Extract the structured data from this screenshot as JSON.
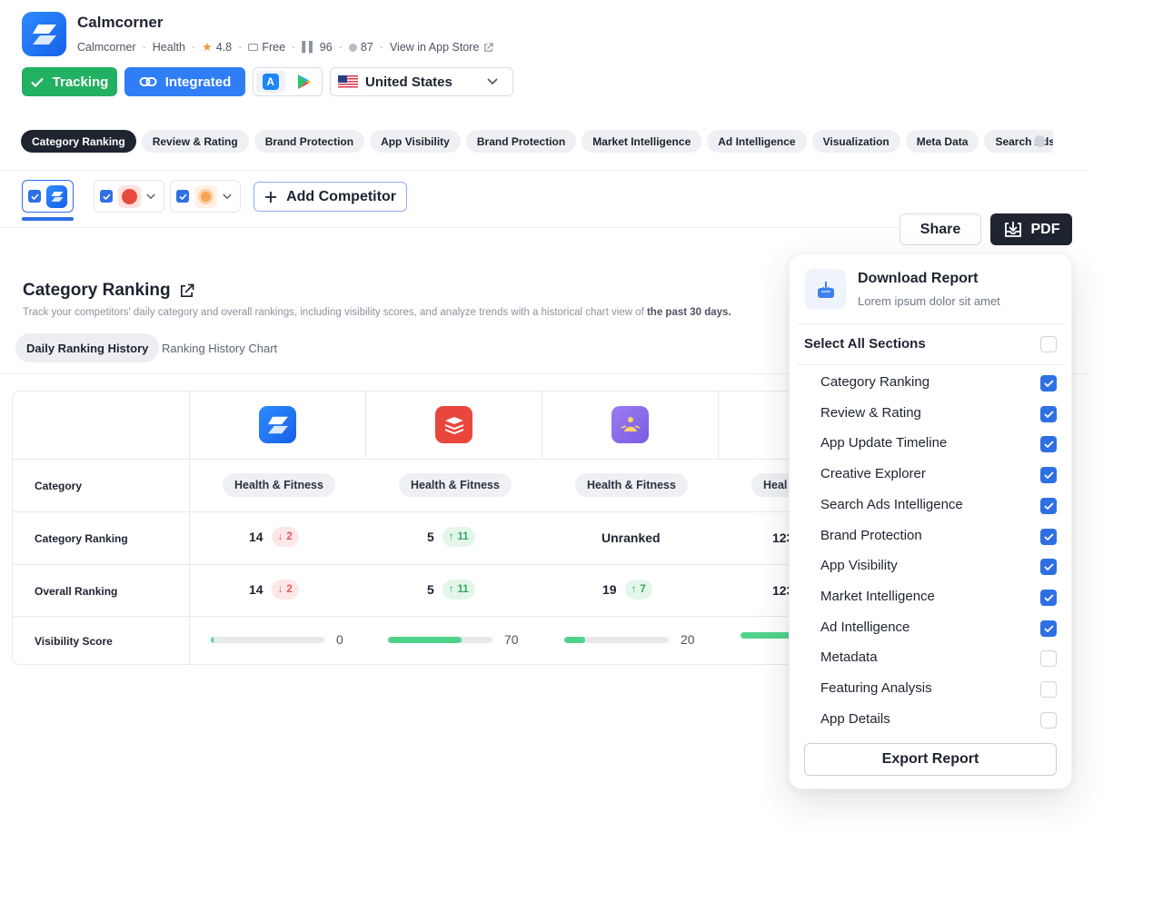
{
  "app": {
    "name": "Calmcorner",
    "developer": "Calmcorner",
    "category": "Health",
    "rating": "4.8",
    "price": "Free",
    "rank_value": "96",
    "score_value": "87",
    "store_link": "View in App Store"
  },
  "actions": {
    "tracking": "Tracking",
    "integrated": "Integrated",
    "country": "United States",
    "share": "Share",
    "pdf": "PDF",
    "add_competitor": "Add Competitor"
  },
  "tabs": [
    "Category Ranking",
    "Review & Rating",
    "Brand Protection",
    "App Visibility",
    "Brand Protection",
    "Market Intelligence",
    "Ad Intelligence",
    "Visualization",
    "Meta Data",
    "Search Ads"
  ],
  "section": {
    "title": "Category Ranking",
    "desc_prefix": "Track your competitors' daily category and overall rankings, including visibility scores, and analyze trends with a historical chart view of ",
    "desc_bold": "the past 30 days.",
    "subtab_active": "Daily Ranking History",
    "subtab_inactive": "Ranking History Chart"
  },
  "table": {
    "row_labels": [
      "Category",
      "Category Ranking",
      "Overall  Ranking",
      "Visibility Score"
    ],
    "columns": [
      {
        "category": "Health & Fitness",
        "cat_rank": "14",
        "cat_change": "2",
        "cat_dir": "down",
        "overall": "14",
        "overall_change": "2",
        "overall_dir": "down",
        "visibility": 0
      },
      {
        "category": "Health & Fitness",
        "cat_rank": "5",
        "cat_change": "11",
        "cat_dir": "up",
        "overall": "5",
        "overall_change": "11",
        "overall_dir": "up",
        "visibility": 70
      },
      {
        "category": "Health & Fitness",
        "cat_rank": "Unranked",
        "overall": "19",
        "overall_change": "7",
        "overall_dir": "up",
        "visibility": 20
      },
      {
        "category": "Heal",
        "cat_rank": "123",
        "overall": "123"
      }
    ]
  },
  "panel": {
    "title": "Download Report",
    "subtitle": "Lorem ipsum dolor sit amet",
    "select_all": "Select All Sections",
    "items": [
      {
        "label": "Category Ranking",
        "checked": true
      },
      {
        "label": "Review & Rating",
        "checked": true
      },
      {
        "label": "App Update Timeline",
        "checked": true
      },
      {
        "label": "Creative Explorer",
        "checked": true
      },
      {
        "label": "Search Ads Intelligence",
        "checked": true
      },
      {
        "label": "Brand Protection",
        "checked": true
      },
      {
        "label": "App Visibility",
        "checked": true
      },
      {
        "label": "Market Intelligence",
        "checked": true
      },
      {
        "label": "Ad Intelligence",
        "checked": true
      },
      {
        "label": "Metadata",
        "checked": false
      },
      {
        "label": "Featuring Analysis",
        "checked": false
      },
      {
        "label": "App Details",
        "checked": false
      }
    ],
    "export": "Export Report"
  },
  "colors": {
    "accent_blue": "#2f6fe4",
    "tracking_green": "#22b062",
    "dark": "#1f2530",
    "visibility_fill": "#4fd38a"
  }
}
